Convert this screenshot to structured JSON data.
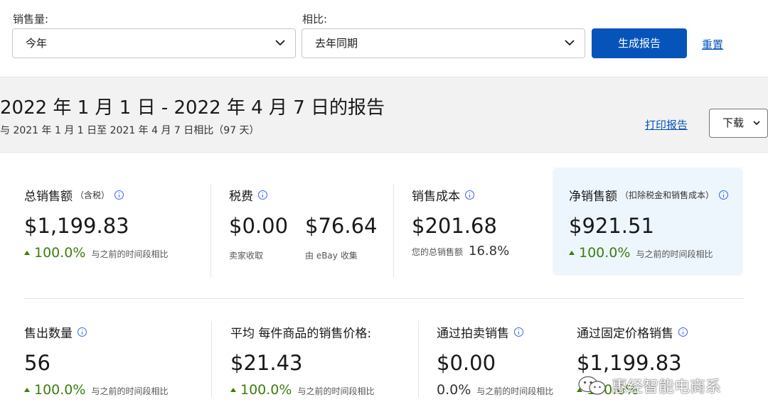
{
  "filters": {
    "sales_label": "销售量:",
    "sales_value": "今年",
    "compare_label": "相比:",
    "compare_value": "去年同期",
    "generate_button": "生成报告",
    "reset_link": "重置"
  },
  "report": {
    "title": "2022 年 1 月 1 日 - 2022 年 4 月 7 日的报告",
    "subtitle": "与 2021 年 1 月 1 日至 2021 年 4 月 7 日相比（97 天）",
    "print_link": "打印报告",
    "download_button": "下载"
  },
  "metrics": {
    "total_sales": {
      "label": "总销售额",
      "note": "（含税）",
      "value": "$1,199.83",
      "change": "100.0%",
      "compare": "与之前的时间段相比"
    },
    "tax": {
      "label": "税费",
      "seller_value": "$0.00",
      "seller_note": "卖家收取",
      "ebay_value": "$76.64",
      "ebay_note": "由 eBay 收集"
    },
    "cost_of_sales": {
      "label": "销售成本",
      "value": "$201.68",
      "note": "您的总销售额",
      "pct": "16.8%"
    },
    "net_sales": {
      "label": "净销售额",
      "note": "（扣除税金和销售成本）",
      "value": "$921.51",
      "change": "100.0%",
      "compare": "与之前的时间段相比"
    },
    "quantity_sold": {
      "label": "售出数量",
      "value": "56",
      "change": "100.0%",
      "compare": "与之前的时间段相比"
    },
    "avg_price": {
      "label": "平均 每件商品的销售价格:",
      "value": "$21.43",
      "change": "100.0%",
      "compare": "与之前的时间段相比"
    },
    "auction_sales": {
      "label": "通过拍卖销售",
      "value": "$0.00",
      "change": "0.0%",
      "compare": "与之前的时间段相比"
    },
    "fixed_price_sales": {
      "label": "通过固定价格销售",
      "value": "$1,199.83",
      "change": "100.0%"
    }
  },
  "watermark": {
    "text": "惠经智能电商系"
  },
  "colors": {
    "primary": "#0654ba",
    "positive": "#3c7d0d",
    "info": "#3665f3",
    "highlight": "#eef6fd"
  }
}
